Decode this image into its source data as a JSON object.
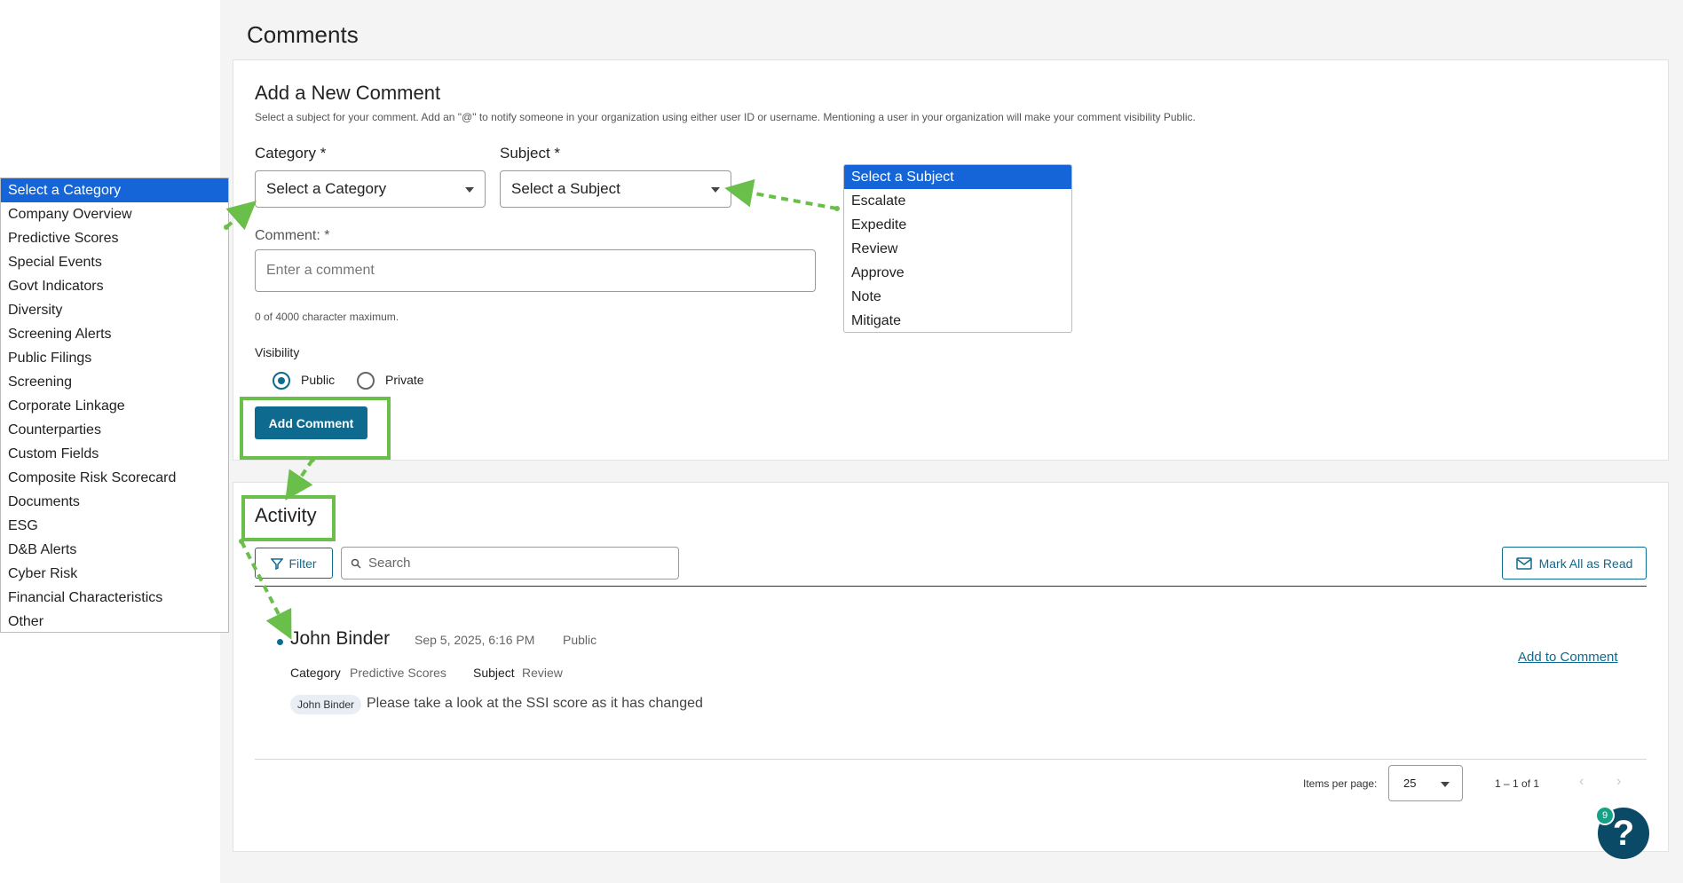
{
  "page": {
    "title": "Comments"
  },
  "new_comment": {
    "heading": "Add a New Comment",
    "help_text": "Select a subject for your comment. Add an \"@\" to notify someone in your organization using either user ID or username. Mentioning a user in your organization will make your comment visibility Public.",
    "category_label": "Category *",
    "category_value": "Select a Category",
    "subject_label": "Subject *",
    "subject_value": "Select a Subject",
    "comment_label": "Comment: *",
    "comment_placeholder": "Enter a comment",
    "char_count": "0 of 4000 character maximum.",
    "visibility_label": "Visibility",
    "visibility_options": [
      "Public",
      "Private"
    ],
    "visibility_selected": "Public",
    "add_button": "Add Comment"
  },
  "category_dropdown": {
    "items": [
      "Select a Category",
      "Company Overview",
      "Predictive Scores",
      "Special Events",
      "Govt Indicators",
      "Diversity",
      "Screening Alerts",
      "Public Filings",
      "Screening",
      "Corporate Linkage",
      "Counterparties",
      "Custom Fields",
      "Composite Risk Scorecard",
      "Documents",
      "ESG",
      "D&B Alerts",
      "Cyber Risk",
      "Financial Characteristics",
      "Other"
    ],
    "selected": "Select a Category"
  },
  "subject_dropdown": {
    "items": [
      "Select a Subject",
      "Escalate",
      "Expedite",
      "Review",
      "Approve",
      "Note",
      "Mitigate"
    ],
    "selected": "Select a Subject"
  },
  "activity": {
    "heading": "Activity",
    "filter_label": "Filter",
    "search_placeholder": "Search",
    "mark_all_label": "Mark All as Read",
    "entry": {
      "author": "John Binder",
      "timestamp": "Sep 5, 2025, 6:16 PM",
      "visibility": "Public",
      "category_label": "Category",
      "category_value": "Predictive Scores",
      "subject_label": "Subject",
      "subject_value": "Review",
      "mention": "John Binder",
      "text": "Please take a look at the SSI score as it has changed",
      "add_link": "Add to Comment"
    },
    "pagination": {
      "items_per_page_label": "Items per page:",
      "items_per_page": "25",
      "range": "1 – 1 of 1"
    }
  },
  "help": {
    "badge_count": "9",
    "icon": "?"
  },
  "colors": {
    "primary": "#0f6a8f",
    "highlight": "#6abf4b",
    "selection": "#1565d8"
  }
}
